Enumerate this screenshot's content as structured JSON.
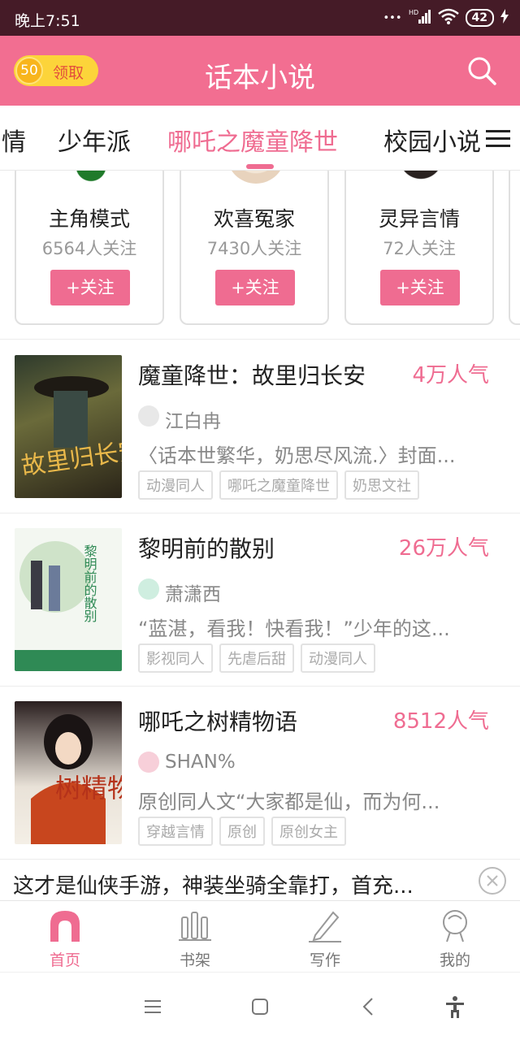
{
  "status_bar": {
    "time": "晚上7:51",
    "signal": "HD",
    "battery": "42"
  },
  "header": {
    "coin_amount": "50",
    "coin_label": "领取",
    "title": "话本小说",
    "search_icon": "search-icon"
  },
  "tabs": [
    "情",
    "少年派",
    "哪吒之魔童降世",
    "校园小说"
  ],
  "cards": [
    {
      "name": "主角模式",
      "count": "6564人关注",
      "follow": "+关注"
    },
    {
      "name": "欢喜冤家",
      "count": "7430人关注",
      "follow": "+关注"
    },
    {
      "name": "灵异言情",
      "count": "72人关注",
      "follow": "+关注"
    }
  ],
  "books": [
    {
      "title": "魔童降世：故里归长安",
      "popularity": "4万人气",
      "author": "江白冉",
      "desc": "〈话本世繁华，奶思尽风流.〉封面...",
      "tags": [
        "动漫同人",
        "哪吒之魔童降世",
        "奶思文社"
      ],
      "cover_text": "故里归长安"
    },
    {
      "title": "黎明前的散别",
      "popularity": "26万人气",
      "author": "萧潇西",
      "desc": "“蓝湛，看我！快看我！”少年的这...",
      "tags": [
        "影视同人",
        "先虐后甜",
        "动漫同人"
      ],
      "cover_text": "黎明前的散别"
    },
    {
      "title": "哪吒之树精物语",
      "popularity": "8512人气",
      "author": "SHAN%",
      "desc": "原创同人文“大家都是仙，而为何...",
      "tags": [
        "穿越言情",
        "原创",
        "原创女主"
      ],
      "cover_text": "树精物语"
    }
  ],
  "ad": {
    "text": "这才是仙侠手游，神装坐骑全靠打，首充..."
  },
  "bottom_nav": [
    {
      "label": "首页",
      "icon": "home-icon",
      "active": true
    },
    {
      "label": "书架",
      "icon": "bookshelf-icon",
      "active": false
    },
    {
      "label": "写作",
      "icon": "pen-icon",
      "active": false
    },
    {
      "label": "我的",
      "icon": "profile-icon",
      "active": false
    }
  ],
  "colors": {
    "accent": "#ef6c91",
    "header": "#f26e91",
    "status_bar": "#451b27"
  }
}
